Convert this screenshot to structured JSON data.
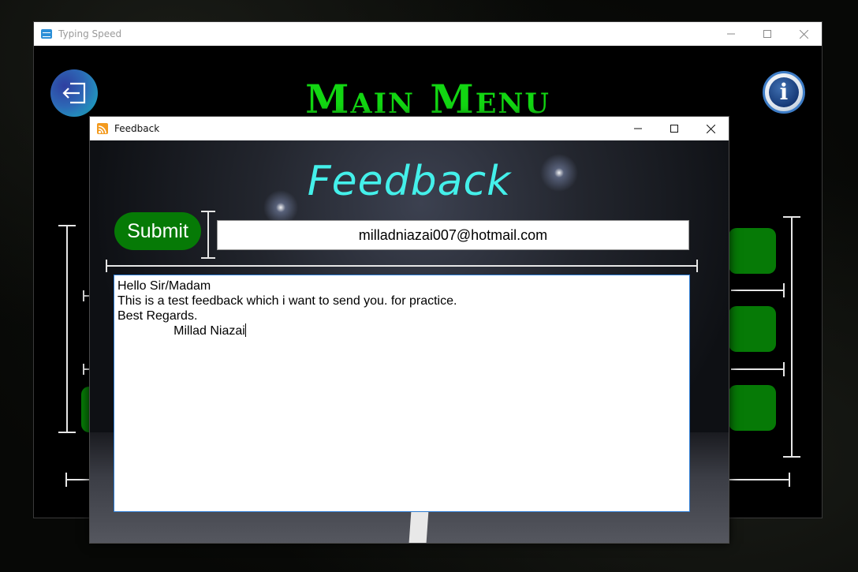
{
  "main_window": {
    "title": "Typing Speed",
    "heading": "Main Menu",
    "icons": {
      "app": "keyboard-icon",
      "exit": "exit-icon",
      "info": "info-icon"
    },
    "info_glyph": "i"
  },
  "feedback_window": {
    "title": "Feedback",
    "heading": "Feedback",
    "submit_label": "Submit",
    "email_value": "milladniazai007@hotmail.com",
    "message_lines": [
      "Hello Sir/Madam",
      "This is a test feedback which i want to send you. for practice.",
      "Best Regards.",
      "                Millad Niazai"
    ],
    "icons": {
      "app": "rss-icon"
    }
  },
  "colors": {
    "main_heading": "#12d612",
    "feedback_heading": "#44f0ea",
    "button_green": "#067a06"
  }
}
